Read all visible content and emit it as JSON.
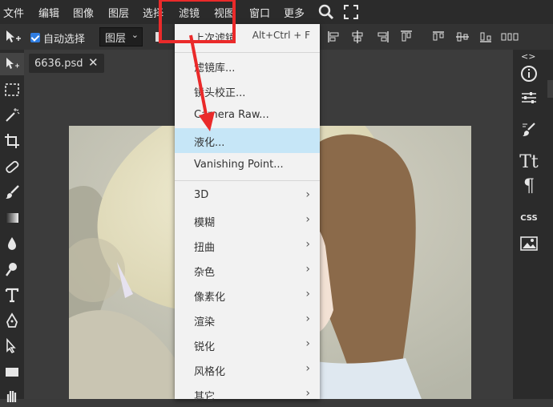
{
  "menubar": {
    "items": [
      "文件",
      "编辑",
      "图像",
      "图层",
      "选择",
      "滤镜",
      "视图",
      "窗口",
      "更多"
    ],
    "icons": [
      "search-icon",
      "fullscreen-icon"
    ]
  },
  "options": {
    "auto_select_label": "自动选择",
    "auto_select_checked": true,
    "layer_select_value": "图层"
  },
  "document": {
    "tab_name": "6636.psd",
    "close_glyph": "✕"
  },
  "filter_menu": {
    "items": [
      {
        "label": "上次滤镜",
        "shortcut": "Alt+Ctrl + F"
      },
      {
        "label": "滤镜库..."
      },
      {
        "label": "镜头校正..."
      },
      {
        "label": "Camera Raw..."
      },
      {
        "label": "液化...",
        "highlighted": true
      },
      {
        "label": "Vanishing Point..."
      },
      {
        "label": "3D",
        "submenu": true
      },
      {
        "label": "模糊",
        "submenu": true
      },
      {
        "label": "扭曲",
        "submenu": true
      },
      {
        "label": "杂色",
        "submenu": true
      },
      {
        "label": "像素化",
        "submenu": true
      },
      {
        "label": "渲染",
        "submenu": true
      },
      {
        "label": "锐化",
        "submenu": true
      },
      {
        "label": "风格化",
        "submenu": true
      },
      {
        "label": "其它",
        "submenu": true
      }
    ],
    "arrow_glyph": "›"
  },
  "right_panel": {
    "css_label": "CSS",
    "text_label": "Tt",
    "paragraph_label": "¶",
    "expand_label": "<>"
  },
  "colors": {
    "accent": "#2f7de1",
    "highlight": "#c6e6f7",
    "annotation": "#ea2a2a"
  }
}
